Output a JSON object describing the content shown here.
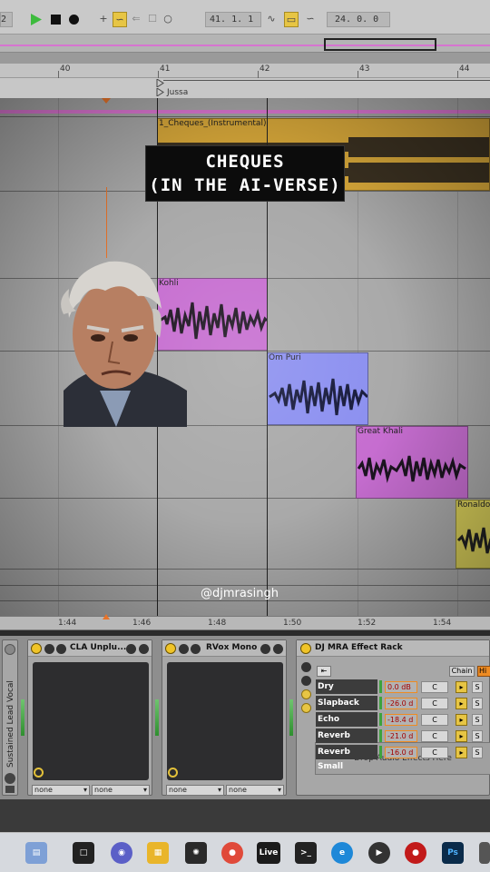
{
  "transport": {
    "left_counter": "2",
    "position": "41.  1.  1",
    "loop_length": "24.  0.  0"
  },
  "ruler": {
    "bars": [
      "40",
      "41",
      "42",
      "43",
      "44"
    ]
  },
  "locators": {
    "jussa": "Jussa"
  },
  "clips": {
    "main": "1_Cheques_(Instrumental)",
    "kohli": "Kohli",
    "ompuri": "Om Puri",
    "khali": "Great Khali",
    "ronaldo": "Ronaldo"
  },
  "overlay": {
    "title_line1": "CHEQUES",
    "title_line2": "(IN THE AI-VERSE)",
    "handle": "@djmrasingh"
  },
  "time_ruler": [
    "1:44",
    "1:46",
    "1:48",
    "1:50",
    "1:52",
    "1:54"
  ],
  "devices": {
    "track_label": "Sustained Lead Vocal",
    "cla": {
      "name": "CLA Unplu...",
      "sel1": "none",
      "sel2": "none"
    },
    "rvox": {
      "name": "RVox Mono",
      "sel1": "none",
      "sel2": "none"
    },
    "rack": {
      "name": "DJ MRA Effect Rack",
      "chain_btn": "Chain",
      "hide_btn": "Hi",
      "rows": [
        {
          "name": "Dry",
          "vol": "0.0 dB",
          "pan": "C",
          "s": "S"
        },
        {
          "name": "Slapback",
          "vol": "-26.0 d",
          "pan": "C",
          "s": "S"
        },
        {
          "name": "Echo",
          "vol": "-18.4 d",
          "pan": "C",
          "s": "S"
        },
        {
          "name": "Reverb",
          "vol": "-21.0 d",
          "pan": "C",
          "s": "S"
        },
        {
          "name": "Reverb Small",
          "vol": "-16.0 d",
          "pan": "C",
          "s": "S"
        }
      ],
      "drop_text": "Drop Audio Effects Here"
    }
  },
  "taskbar": {
    "live_label": "Live",
    "ps_label": "Ps",
    "icons": [
      "widgets-icon",
      "task-view-icon",
      "teams-icon",
      "file-explorer-icon",
      "network-icon",
      "chrome-icon",
      "ableton-live-icon",
      "terminal-icon",
      "edge-icon",
      "media-player-icon",
      "record-icon",
      "photoshop-icon",
      "apps-icon"
    ]
  },
  "colors": {
    "main_clip": "#d9a93a",
    "kohli": "#c66dd0",
    "ompuri": "#8b8ff0",
    "khali": "#c66dd0",
    "ronaldo": "#d9cf5a",
    "accent_yellow": "#e7c544",
    "play_green": "#3dbb3d"
  }
}
